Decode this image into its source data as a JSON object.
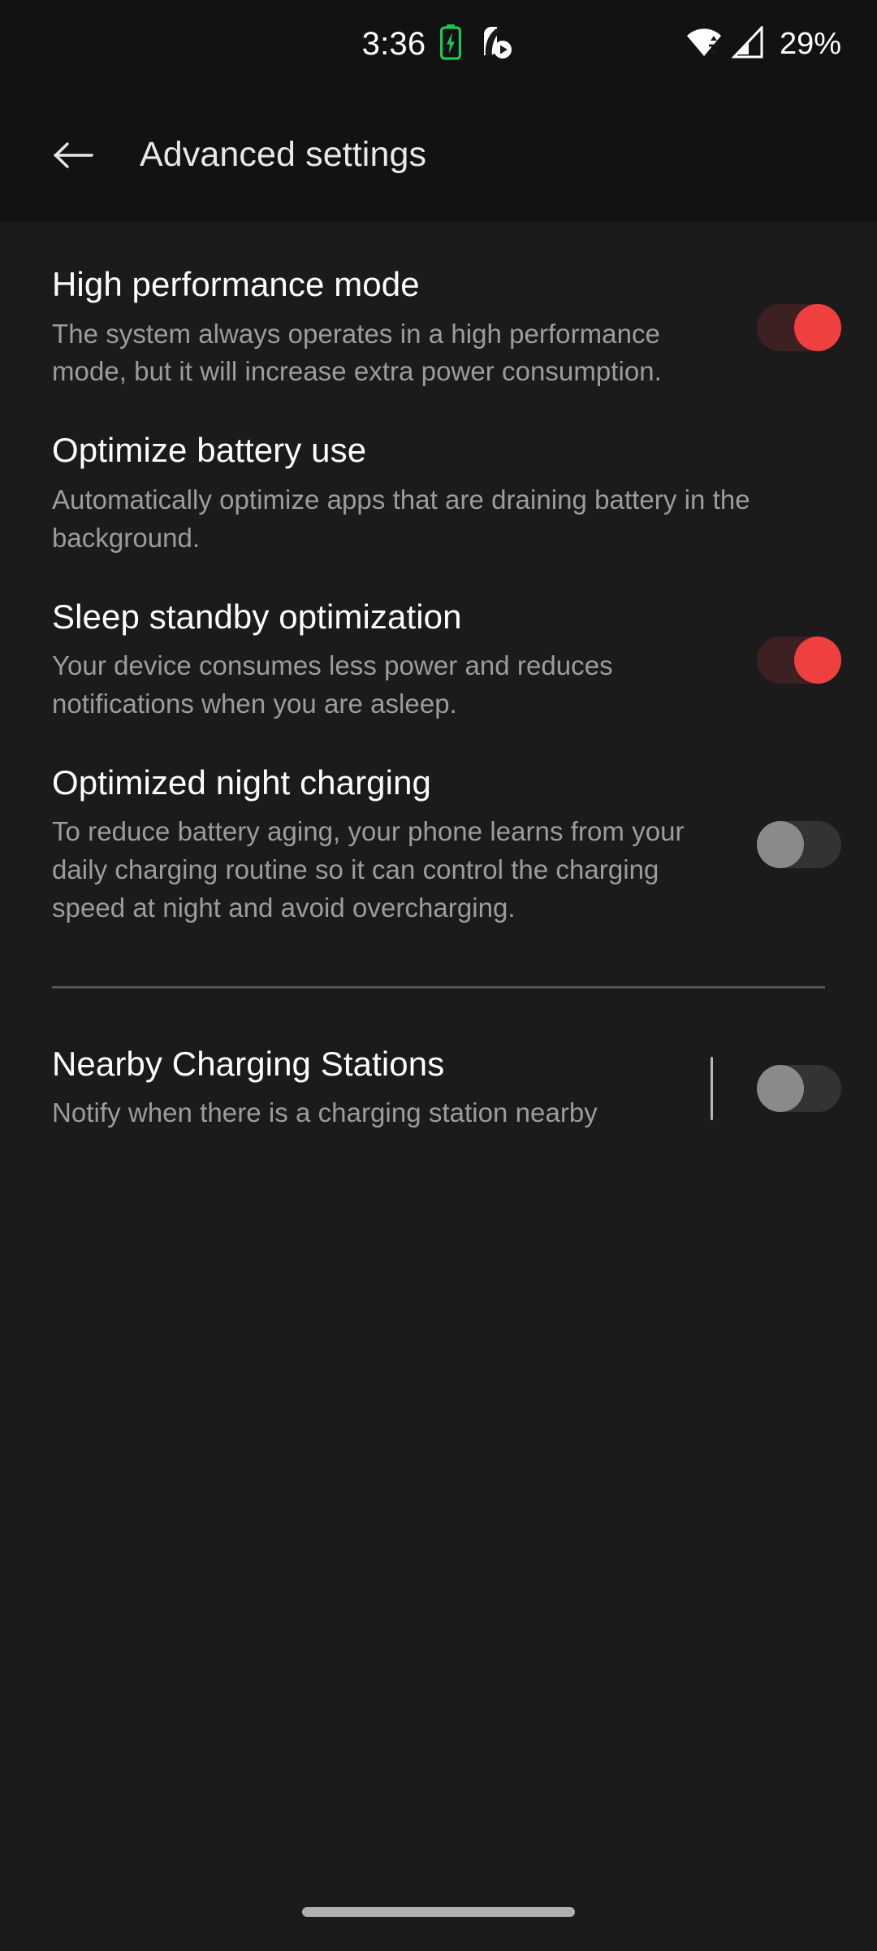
{
  "status_bar": {
    "time": "3:36",
    "battery_percent": "29%",
    "icons": {
      "battery_charging": "battery-charging-icon",
      "media_notification": "media-play-notification-icon",
      "wifi": "wifi-icon",
      "cellular": "cellular-signal-icon"
    },
    "colors": {
      "battery_charging": "#23c552",
      "text": "#ffffff"
    }
  },
  "app_bar": {
    "back_label": "back-arrow",
    "title": "Advanced settings"
  },
  "colors": {
    "background": "#1b1b1b",
    "bar_background": "#121212",
    "accent_on": "#ef4040",
    "track_on": "#3d2022",
    "track_off": "#333333",
    "knob_off": "#8a8a8a",
    "title_text": "#ffffff",
    "summary_text": "#9c9c9c",
    "divider": "#555555"
  },
  "sections": [
    {
      "name": "primary",
      "items": [
        {
          "title": "High performance mode",
          "summary": "The system always operates in a high performance mode, but it will increase extra power consumption.",
          "has_switch": true,
          "switch_state": "on",
          "has_divider": false
        },
        {
          "title": "Optimize battery use",
          "summary": "Automatically optimize apps that are draining battery in the background.",
          "has_switch": false,
          "switch_state": "",
          "has_divider": false
        },
        {
          "title": "Sleep standby optimization",
          "summary": "Your device consumes less power and reduces notifications when you are asleep.",
          "has_switch": true,
          "switch_state": "on",
          "has_divider": false
        },
        {
          "title": "Optimized night charging",
          "summary": "To reduce battery aging, your phone learns from your daily charging routine so it can control the charging speed at night and avoid overcharging.",
          "has_switch": true,
          "switch_state": "off",
          "has_divider": false
        }
      ]
    },
    {
      "name": "secondary",
      "items": [
        {
          "title": "Nearby Charging Stations",
          "summary": "Notify when there is a charging station nearby",
          "has_switch": true,
          "switch_state": "off",
          "has_divider": true
        }
      ]
    }
  ]
}
